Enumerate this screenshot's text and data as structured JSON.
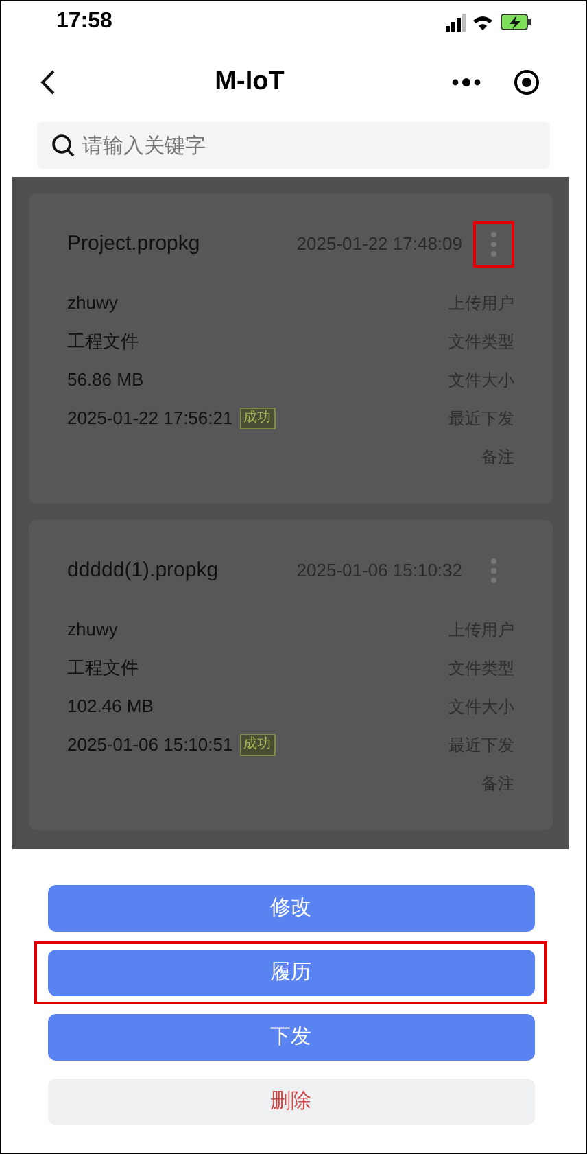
{
  "status_bar": {
    "time": "17:58"
  },
  "nav": {
    "title": "M-IoT"
  },
  "search": {
    "placeholder": "请输入关键字"
  },
  "files": [
    {
      "name": "Project.propkg",
      "uploaded": "2025-01-22 17:48:09",
      "menu_highlighted": true,
      "fields": [
        {
          "value": "zhuwy",
          "label": "上传用户"
        },
        {
          "value": "工程文件",
          "label": "文件类型"
        },
        {
          "value": "56.86 MB",
          "label": "文件大小"
        },
        {
          "value": "2025-01-22 17:56:21",
          "badge": "成功",
          "label": "最近下发"
        },
        {
          "label": "备注"
        }
      ]
    },
    {
      "name": "ddddd(1).propkg",
      "uploaded": "2025-01-06 15:10:32",
      "menu_highlighted": false,
      "fields": [
        {
          "value": "zhuwy",
          "label": "上传用户"
        },
        {
          "value": "工程文件",
          "label": "文件类型"
        },
        {
          "value": "102.46 MB",
          "label": "文件大小"
        },
        {
          "value": "2025-01-06 15:10:51",
          "badge": "成功",
          "label": "最近下发"
        },
        {
          "label": "备注"
        }
      ]
    }
  ],
  "action_sheet": [
    {
      "label": "修改",
      "kind": "primary",
      "highlighted": false
    },
    {
      "label": "履历",
      "kind": "primary",
      "highlighted": true
    },
    {
      "label": "下发",
      "kind": "primary",
      "highlighted": false
    },
    {
      "label": "删除",
      "kind": "danger",
      "highlighted": false
    }
  ]
}
